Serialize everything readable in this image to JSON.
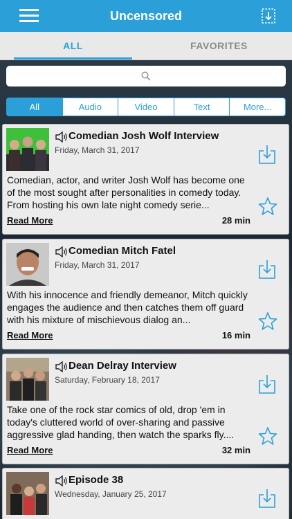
{
  "header": {
    "title": "Uncensored"
  },
  "tabs": [
    {
      "label": "ALL"
    },
    {
      "label": "FAVORITES"
    }
  ],
  "search": {
    "placeholder": ""
  },
  "filters": [
    {
      "label": "All"
    },
    {
      "label": "Audio"
    },
    {
      "label": "Video"
    },
    {
      "label": "Text"
    },
    {
      "label": "More..."
    }
  ],
  "colors": {
    "accent": "#2b9fd8",
    "card_bg": "#ececec"
  },
  "episodes": [
    {
      "title": "Comedian Josh Wolf Interview",
      "date": "Friday, March 31, 2017",
      "description": "Comedian, actor, and writer Josh Wolf has become one of the most sought after personalities in comedy today. From hosting his own late night comedy serie...",
      "read_more": "Read More",
      "duration": "28 min",
      "media_icon": "speaker-icon"
    },
    {
      "title": "Comedian Mitch Fatel",
      "date": "Friday, March 31, 2017",
      "description": "With his innocence and friendly demeanor, Mitch quickly engages the audience and then catches them off guard with his mixture of mischievous dialog an...",
      "read_more": "Read More",
      "duration": "16 min",
      "media_icon": "speaker-icon"
    },
    {
      "title": "Dean Delray Interview",
      "date": "Saturday, February 18, 2017",
      "description": "Take one of the rock star comics of old, drop 'em in today's cluttered world of over-sharing and passive aggressive glad handing, then watch the sparks fly....",
      "read_more": "Read More",
      "duration": "32 min",
      "media_icon": "speaker-icon"
    },
    {
      "title": "Episode 38",
      "date": "Wednesday, January 25, 2017",
      "media_icon": "speaker-icon"
    }
  ]
}
